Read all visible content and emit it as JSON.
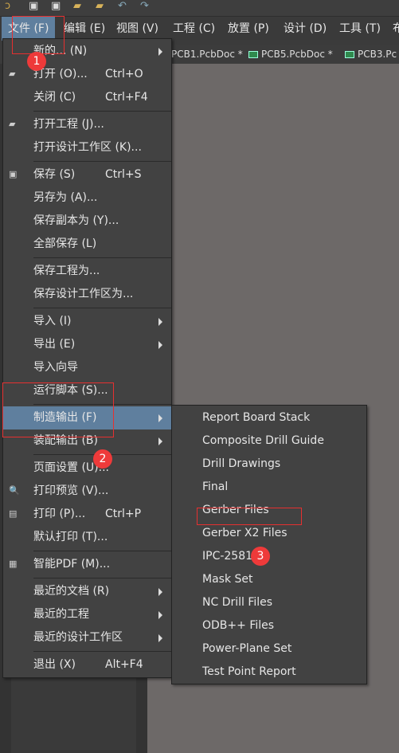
{
  "toolbar": {
    "icons": [
      "app-logo-icon",
      "save-icon",
      "save-all-icon",
      "open-folder-icon",
      "open-project-icon",
      "undo-icon",
      "redo-icon"
    ]
  },
  "menubar": [
    "文件 (F)",
    "编辑 (E)",
    "视图 (V)",
    "工程 (C)",
    "放置 (P)",
    "设计 (D)",
    "工具 (T)",
    "布"
  ],
  "tabs": [
    "PCB1.PcbDoc *",
    "PCB5.PcbDoc *",
    "PCB3.Pc"
  ],
  "file_menu": [
    {
      "label": "新的... (N)",
      "submenu": true
    },
    {
      "label": "打开 (O)...",
      "shortcut": "Ctrl+O",
      "icon": "open-folder-icon"
    },
    {
      "label": "关闭 (C)",
      "shortcut": "Ctrl+F4"
    },
    {
      "sep": true
    },
    {
      "label": "打开工程 (J)...",
      "icon": "open-project-icon"
    },
    {
      "label": "打开设计工作区 (K)..."
    },
    {
      "sep": true
    },
    {
      "label": "保存 (S)",
      "shortcut": "Ctrl+S",
      "icon": "save-icon"
    },
    {
      "label": "另存为 (A)..."
    },
    {
      "label": "保存副本为 (Y)..."
    },
    {
      "label": "全部保存 (L)"
    },
    {
      "sep": true
    },
    {
      "label": "保存工程为..."
    },
    {
      "label": "保存设计工作区为..."
    },
    {
      "sep": true
    },
    {
      "label": "导入 (I)",
      "submenu": true
    },
    {
      "label": "导出 (E)",
      "submenu": true
    },
    {
      "label": "导入向导"
    },
    {
      "label": "运行脚本 (S)..."
    },
    {
      "sep": true
    },
    {
      "label": "制造输出 (F)",
      "submenu": true,
      "highlighted": true
    },
    {
      "label": "装配输出 (B)",
      "submenu": true
    },
    {
      "sep": true
    },
    {
      "label": "页面设置 (U)..."
    },
    {
      "label": "打印预览 (V)...",
      "icon": "print-preview-icon"
    },
    {
      "label": "打印 (P)...",
      "shortcut": "Ctrl+P",
      "icon": "printer-icon"
    },
    {
      "label": "默认打印 (T)..."
    },
    {
      "sep": true
    },
    {
      "label": "智能PDF (M)...",
      "icon": "pdf-icon"
    },
    {
      "sep": true
    },
    {
      "label": "最近的文档 (R)",
      "submenu": true
    },
    {
      "label": "最近的工程",
      "submenu": true
    },
    {
      "label": "最近的设计工作区",
      "submenu": true
    },
    {
      "sep": true
    },
    {
      "label": "退出 (X)",
      "shortcut": "Alt+F4"
    }
  ],
  "fab_submenu": [
    "Report Board Stack",
    "Composite Drill Guide",
    "Drill Drawings",
    "Final",
    "Gerber Files",
    "Gerber X2 Files",
    "IPC-2581",
    "Mask Set",
    "NC Drill Files",
    "ODB++ Files",
    "Power-Plane Set",
    "Test Point Report"
  ],
  "annotations": [
    "1",
    "2",
    "3"
  ],
  "colors": {
    "highlight": "#5f7f9e",
    "annotation": "#ee3a3a",
    "menu_bg": "#424242"
  }
}
